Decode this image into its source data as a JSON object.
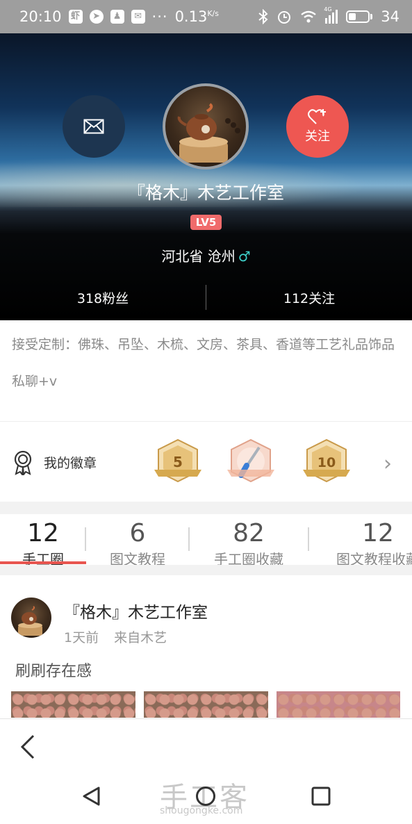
{
  "status_bar": {
    "time": "20:10",
    "app_icons": [
      "shrimp-app-icon",
      "compass-app-icon",
      "notification-icon",
      "mail-icon"
    ],
    "dots": "···",
    "speed": "0.13",
    "speed_unit": "K/s",
    "signal_label": "4G",
    "battery": "34"
  },
  "profile": {
    "name": "『格木』木艺工作室",
    "level": "LV5",
    "location": "河北省 沧州",
    "gender_symbol": "♂",
    "follow_label": "关注",
    "fans": "318粉丝",
    "following": "112关注",
    "bio": "接受定制：佛珠、吊坠、木梳、文房、茶具、香道等工艺礼品饰品",
    "bio_line2": "私聊+v"
  },
  "badges": {
    "title": "我的徽章",
    "items": [
      {
        "label": "5",
        "icon": "level-5-badge"
      },
      {
        "label": "",
        "icon": "screwdriver-badge"
      },
      {
        "label": "10",
        "icon": "level-10-badge"
      }
    ]
  },
  "tabs": [
    {
      "count": "12",
      "label": "手工圈"
    },
    {
      "count": "6",
      "label": "图文教程"
    },
    {
      "count": "82",
      "label": "手工圈收藏"
    },
    {
      "count": "12",
      "label": "图文教程收藏"
    }
  ],
  "post": {
    "author": "『格木』木艺工作室",
    "time": "1天前",
    "source": "来自木艺",
    "text": "刷刷存在感"
  },
  "watermark": {
    "text": "手工客",
    "sub": "shougongke.com"
  },
  "colors": {
    "accent": "#e8554f",
    "follow": "#ee5752",
    "message": "#1d3550",
    "level": "#f06b6b",
    "gender": "#3ed0c9"
  }
}
